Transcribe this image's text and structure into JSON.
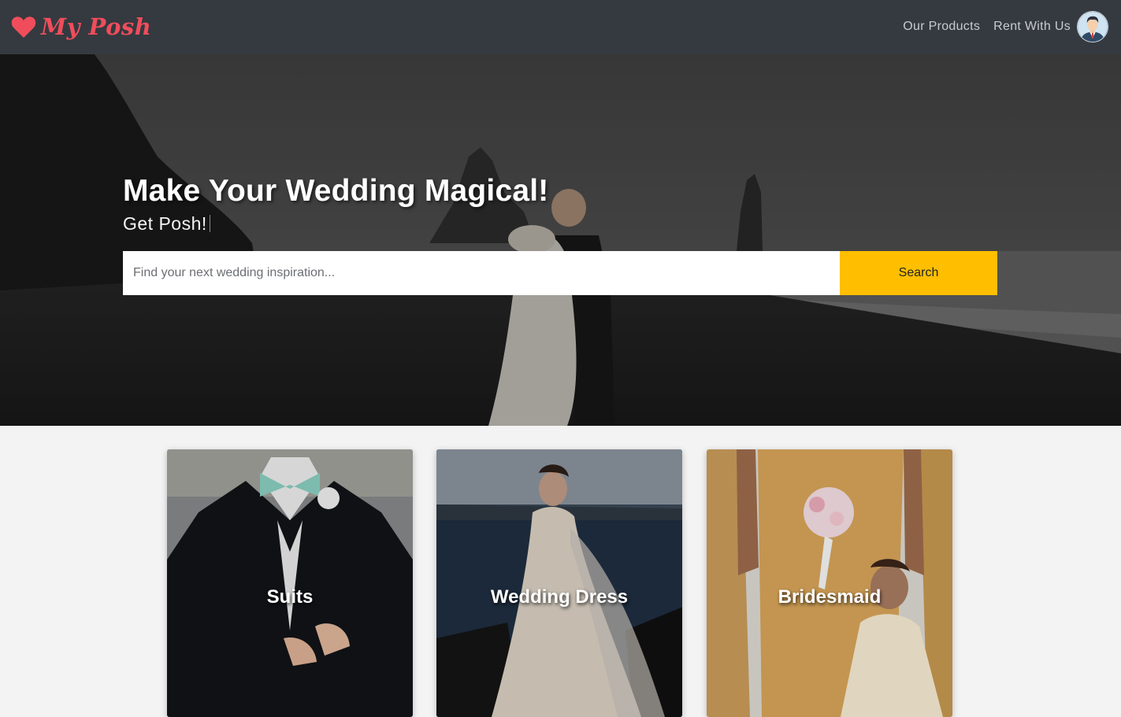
{
  "navbar": {
    "brand": "My Posh",
    "links": [
      "Our Products",
      "Rent With Us"
    ],
    "icons": {
      "brand": "heart-icon",
      "avatar": "user-avatar"
    },
    "brand_color": "#ef4d5b",
    "background": "#343a40"
  },
  "hero": {
    "title": "Make Your Wedding Magical!",
    "subtitle": "Get Posh!",
    "search": {
      "placeholder": "Find your next wedding inspiration...",
      "value": "",
      "button_label": "Search",
      "button_color": "#ffbf00"
    }
  },
  "categories": [
    {
      "label": "Suits"
    },
    {
      "label": "Wedding Dress"
    },
    {
      "label": "Bridesmaid"
    }
  ]
}
